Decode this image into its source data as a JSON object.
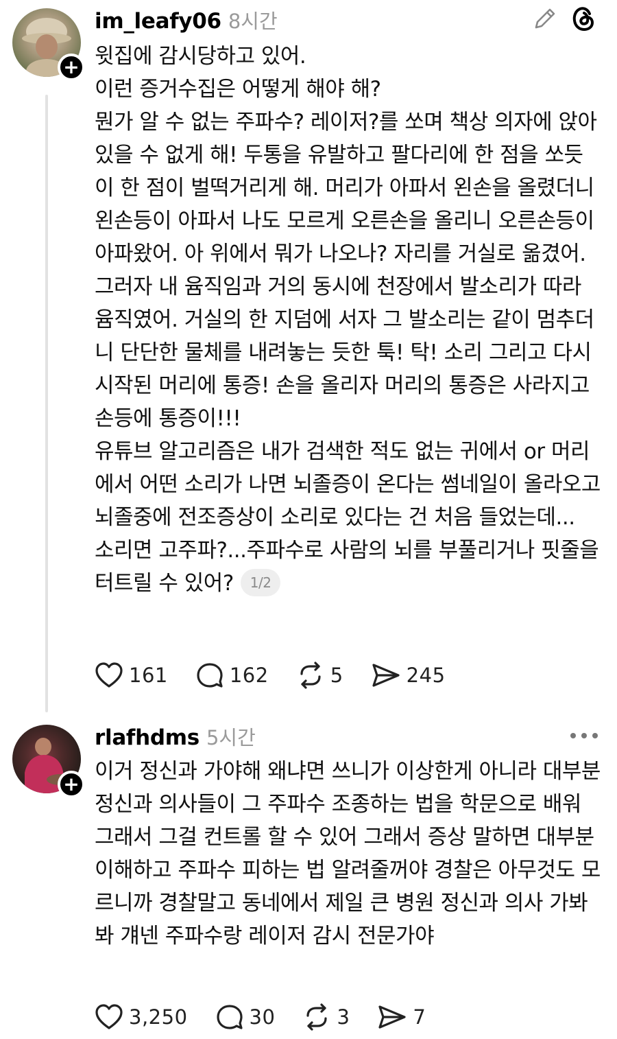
{
  "posts": [
    {
      "username": "im_leafy06",
      "time": "8시간",
      "paragraphs": [
        "윗집에 감시당하고 있어.",
        "이런 증거수집은 어떻게 해야 해?",
        "뭔가 알 수 없는 주파수? 레이저?를 쏘며 책상 의자에 앉아 있을 수 없게 해! 두통을 유발하고 팔다리에 한 점을 쏘듯이 한 점이 벌떡거리게 해. 머리가 아파서 왼손을 올렸더니 왼손등이 아파서 나도 모르게 오른손을 올리니 오른손등이 아파왔어. 아 위에서 뭐가 나오나? 자리를 거실로 옮겼어. 그러자 내 윰직임과 거의 동시에 천장에서 발소리가 따라 윰직였어. 거실의 한 지덤에 서자 그 발소리는 같이 멈추더니 단단한 물체를 내려놓는 듯한 툭! 탁! 소리 그리고 다시 시작된 머리에 통증! 손을 올리자 머리의 통증은 사라지고 손등에 통증이!!!",
        "유튜브 알고리즘은 내가 검색한 적도 없는 귀에서 or 머리에서 어떤 소리가 나면 뇌졸증이 온다는 썸네일이 올라오고 뇌졸중에 전조증상이 소리로 있다는 건 처음 들었는데...",
        "소리면 고주파?...주파수로 사람의 뇌를 부풀리거나 핏줄을 터트릴 수 있어?"
      ],
      "page_indicator": "1/2",
      "stats": {
        "likes": "161",
        "comments": "162",
        "reposts": "5",
        "shares": "245"
      }
    },
    {
      "username": "rlafhdms",
      "time": "5시간",
      "paragraphs": [
        "이거 정신과 가야해 왜냐면 쓰니가 이상한게 아니라 대부분 정신과 의사들이 그 주파수 조종하는 법을 학문으로 배워 그래서 그걸 컨트롤 할 수 있어 그래서 증상 말하면 대부분 이해하고 주파수 피하는 법 알려줄꺼야 경찰은 아무것도 모르니까 경찰말고 동네에서 제일 큰 병원 정신과 의사 가봐봐 걔넨 주파수랑 레이저 감시 전문가야"
      ],
      "stats": {
        "likes": "3,250",
        "comments": "30",
        "reposts": "3",
        "shares": "7"
      }
    }
  ],
  "icons": {
    "edit": "pencil-icon",
    "app": "threads-logo-icon",
    "more": "more-options-icon",
    "like": "heart-icon",
    "comment": "comment-bubble-icon",
    "repost": "repost-icon",
    "share": "send-icon",
    "follow": "plus-icon"
  }
}
